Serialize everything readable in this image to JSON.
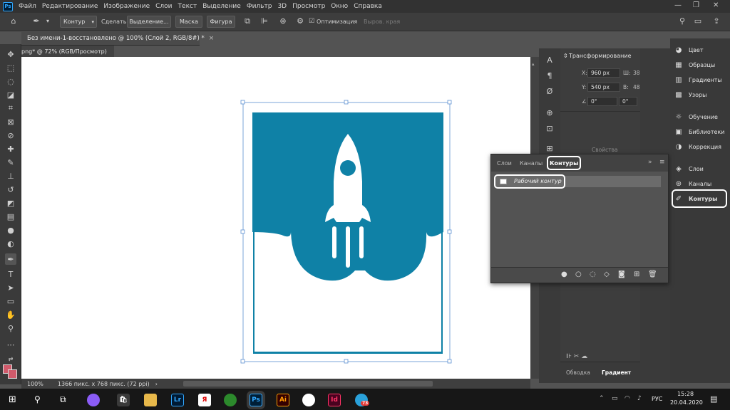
{
  "menubar": {
    "logo": "Ps",
    "items": [
      "Файл",
      "Редактирование",
      "Изображение",
      "Слои",
      "Текст",
      "Выделение",
      "Фильтр",
      "3D",
      "Просмотр",
      "Окно",
      "Справка"
    ]
  },
  "options": {
    "mode_select": "Контур",
    "make_label": "Сделать:",
    "selection_btn": "Выделение...",
    "mask_btn": "Маска",
    "shape_btn": "Фигура",
    "optimize_label": "Оптимизация",
    "align_edges_label": "Выров. края"
  },
  "document": {
    "tab_title": "Без имени-1-восстановлено @ 100% (Слой 2, RGB/8#) *",
    "tab2_title": "png* @ 72% (RGB/Просмотр)",
    "zoom": "100%",
    "size_info": "1366 пикс. x 768 пикс. (72 ppi)"
  },
  "properties": {
    "title": "Трансформирование",
    "x_label": "X:",
    "x_value": "960 px",
    "y_label": "Y:",
    "y_value": "540 px",
    "w_label": "Ш:",
    "w_value": "38",
    "h_label": "В:",
    "h_value": "48",
    "angle_value": "0°",
    "angle_value2": "0°",
    "shape_props": "Свойства фигуры н"
  },
  "paths_panel": {
    "tabs": [
      "Слои",
      "Каналы",
      "Контуры"
    ],
    "active_tab": "Контуры",
    "work_path": "Рабочий контур"
  },
  "bottom_tabs": [
    "Обводка",
    "Градиент"
  ],
  "right_panel": {
    "items": [
      {
        "label": "Цвет",
        "icon": "palette-icon"
      },
      {
        "label": "Образцы",
        "icon": "grid-icon"
      },
      {
        "label": "Градиенты",
        "icon": "gradient-icon"
      },
      {
        "label": "Узоры",
        "icon": "pattern-icon"
      },
      {
        "label": "Обучение",
        "icon": "bulb-icon"
      },
      {
        "label": "Библиотеки",
        "icon": "library-icon"
      },
      {
        "label": "Коррекция",
        "icon": "adjust-icon"
      },
      {
        "label": "Слои",
        "icon": "layers-icon"
      },
      {
        "label": "Каналы",
        "icon": "channels-icon"
      },
      {
        "label": "Контуры",
        "icon": "paths-icon"
      }
    ]
  },
  "taskbar": {
    "lang": "РУС",
    "time": "15:28",
    "date": "20.04.2020",
    "telegram_badge": "73",
    "apps": [
      "Lr",
      "Я",
      "Ps",
      "Ai",
      "Id"
    ]
  },
  "colors": {
    "rocket_blue": "#0f81a6",
    "highlight": "#ffffff",
    "panel_bg": "#535353"
  }
}
